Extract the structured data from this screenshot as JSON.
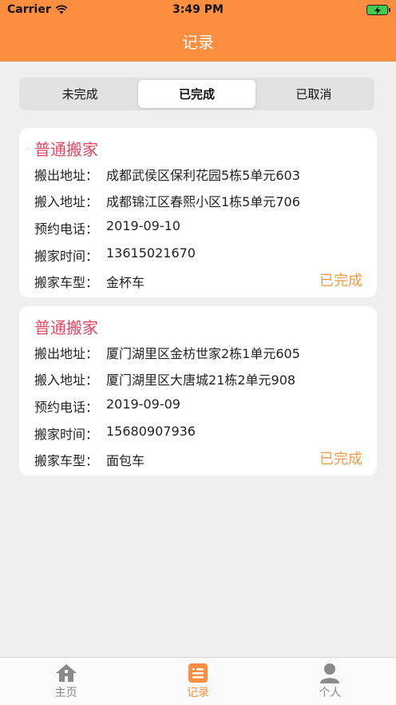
{
  "status_bar": {
    "carrier": "Carrier",
    "time": "3:49 PM"
  },
  "header": {
    "title": "记录"
  },
  "segments": [
    {
      "label": "未完成",
      "active": false
    },
    {
      "label": "已完成",
      "active": true
    },
    {
      "label": "已取消",
      "active": false
    }
  ],
  "records": [
    {
      "title": "普通搬家",
      "rows": [
        {
          "label": "搬出地址：",
          "value": "成都武侯区保利花园5栋5单元603"
        },
        {
          "label": "搬入地址：",
          "value": "成都锦江区春熙小区1栋5单元706"
        },
        {
          "label": "预约电话：",
          "value": "2019-09-10"
        },
        {
          "label": "搬家时间：",
          "value": "13615021670"
        },
        {
          "label": "搬家车型：",
          "value": "金杯车"
        }
      ],
      "status": "已完成"
    },
    {
      "title": "普通搬家",
      "rows": [
        {
          "label": "搬出地址：",
          "value": "厦门湖里区金枋世家2栋1单元605"
        },
        {
          "label": "搬入地址：",
          "value": "厦门湖里区大唐城21栋2单元908"
        },
        {
          "label": "预约电话：",
          "value": "2019-09-09"
        },
        {
          "label": "搬家时间：",
          "value": "15680907936"
        },
        {
          "label": "搬家车型：",
          "value": "面包车"
        }
      ],
      "status": "已完成"
    }
  ],
  "tabbar": [
    {
      "label": "主页",
      "icon": "home-icon",
      "active": false
    },
    {
      "label": "记录",
      "icon": "list-icon",
      "active": true
    },
    {
      "label": "个人",
      "icon": "person-icon",
      "active": false
    }
  ],
  "colors": {
    "accent": "#fd8e3f",
    "title_red": "#e6455f",
    "status_orange": "#f59a47"
  }
}
